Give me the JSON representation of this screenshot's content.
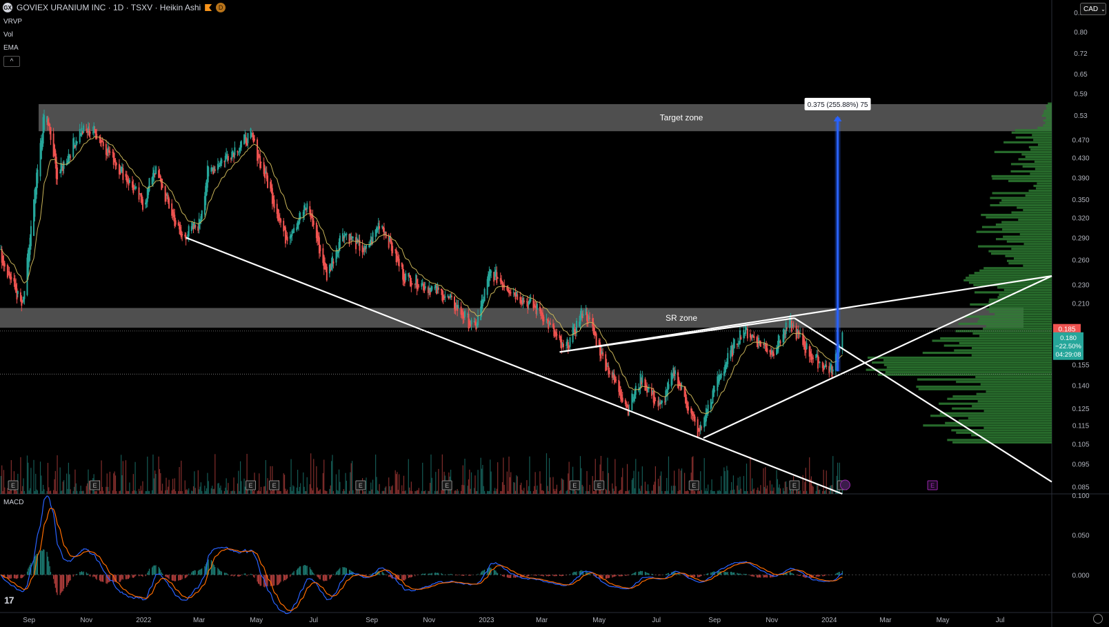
{
  "header": {
    "title": "GOVIEX URANIUM INC · 1D · TSXV · Heikin Ashi",
    "logo_text": "GX",
    "badge_d": "D"
  },
  "indicators": [
    "VRVP",
    "Vol",
    "EMA"
  ],
  "collapse_icon": "chevron-up-icon",
  "currency": "CAD",
  "macd_label": "MACD",
  "price_axis": {
    "labels": [
      "0.88",
      "0.80",
      "0.72",
      "0.65",
      "0.59",
      "0.53",
      "0.470",
      "0.430",
      "0.390",
      "0.350",
      "0.320",
      "0.290",
      "0.260",
      "0.230",
      "0.210",
      "0.155",
      "0.140",
      "0.125",
      "0.115",
      "0.105",
      "0.095",
      "0.085"
    ],
    "current_red": "0.185",
    "current_green": "0.180",
    "change": "−22.50%",
    "countdown": "04:29:08"
  },
  "macd_axis": {
    "labels": [
      "0.100",
      "0.050",
      "0.000"
    ]
  },
  "time_axis": {
    "labels": [
      "Sep",
      "Nov",
      "2022",
      "Mar",
      "May",
      "Jul",
      "Sep",
      "Nov",
      "2023",
      "Mar",
      "May",
      "Jul",
      "Sep",
      "Nov",
      "2024",
      "Mar",
      "May",
      "Jul"
    ]
  },
  "annotations": {
    "target_zone": "Target zone",
    "sr_zone": "SR zone",
    "measure_label": "0.375 (255.88%) 75"
  },
  "earnings_marker": "E",
  "colors": {
    "up": "#26a69a",
    "down": "#ef5350",
    "ema": "#c9b458",
    "zone": "#5d5d5d",
    "vrvp": "#2e7d32",
    "measure": "#2962ff",
    "macd_line": "#2962ff",
    "signal_line": "#ff6d00",
    "earnings": "#9c27b0"
  },
  "chart_data": {
    "type": "candlestick",
    "style": "Heikin Ashi",
    "ylim": [
      0.082,
      0.88
    ],
    "y_scale": "log",
    "anchors": [
      {
        "date": "2021-08-01",
        "price": 0.27
      },
      {
        "date": "2021-08-25",
        "price": 0.205
      },
      {
        "date": "2021-09-05",
        "price": 0.33
      },
      {
        "date": "2021-09-18",
        "price": 0.55
      },
      {
        "date": "2021-10-01",
        "price": 0.39
      },
      {
        "date": "2021-10-25",
        "price": 0.49
      },
      {
        "date": "2021-11-10",
        "price": 0.49
      },
      {
        "date": "2021-12-15",
        "price": 0.385
      },
      {
        "date": "2022-01-01",
        "price": 0.34
      },
      {
        "date": "2022-01-12",
        "price": 0.41
      },
      {
        "date": "2022-02-10",
        "price": 0.29
      },
      {
        "date": "2022-03-01",
        "price": 0.31
      },
      {
        "date": "2022-03-10",
        "price": 0.4
      },
      {
        "date": "2022-04-25",
        "price": 0.48
      },
      {
        "date": "2022-05-15",
        "price": 0.37
      },
      {
        "date": "2022-06-01",
        "price": 0.29
      },
      {
        "date": "2022-06-25",
        "price": 0.34
      },
      {
        "date": "2022-07-15",
        "price": 0.24
      },
      {
        "date": "2022-08-01",
        "price": 0.3
      },
      {
        "date": "2022-08-25",
        "price": 0.27
      },
      {
        "date": "2022-09-10",
        "price": 0.315
      },
      {
        "date": "2022-10-05",
        "price": 0.24
      },
      {
        "date": "2022-11-15",
        "price": 0.22
      },
      {
        "date": "2022-12-01",
        "price": 0.205
      },
      {
        "date": "2022-12-20",
        "price": 0.185
      },
      {
        "date": "2023-01-05",
        "price": 0.245
      },
      {
        "date": "2023-02-01",
        "price": 0.22
      },
      {
        "date": "2023-03-01",
        "price": 0.2
      },
      {
        "date": "2023-03-25",
        "price": 0.165
      },
      {
        "date": "2023-04-15",
        "price": 0.205
      },
      {
        "date": "2023-05-05",
        "price": 0.16
      },
      {
        "date": "2023-06-01",
        "price": 0.125
      },
      {
        "date": "2023-06-15",
        "price": 0.145
      },
      {
        "date": "2023-07-05",
        "price": 0.125
      },
      {
        "date": "2023-07-20",
        "price": 0.15
      },
      {
        "date": "2023-08-15",
        "price": 0.11
      },
      {
        "date": "2023-09-05",
        "price": 0.145
      },
      {
        "date": "2023-10-01",
        "price": 0.185
      },
      {
        "date": "2023-11-01",
        "price": 0.165
      },
      {
        "date": "2023-11-20",
        "price": 0.19
      },
      {
        "date": "2023-12-15",
        "price": 0.16
      },
      {
        "date": "2024-01-05",
        "price": 0.15
      },
      {
        "date": "2024-01-15",
        "price": 0.185
      }
    ],
    "zones": [
      {
        "label": "Target zone",
        "low": 0.49,
        "high": 0.56
      },
      {
        "label": "SR zone",
        "low": 0.186,
        "high": 0.205
      }
    ],
    "trendlines": [
      {
        "from": [
          "2022-02-15",
          0.29
        ],
        "to": [
          "2024-01-15",
          0.082
        ]
      },
      {
        "from": [
          "2023-03-20",
          0.165
        ],
        "to": [
          "2023-11-25",
          0.195
        ]
      },
      {
        "from": [
          "2023-03-20",
          0.165
        ],
        "to": [
          "2024-08-25",
          0.24
        ]
      },
      {
        "from": [
          "2023-11-25",
          0.195
        ],
        "to": [
          "2024-08-25",
          0.087
        ]
      },
      {
        "from": [
          "2023-08-20",
          0.108
        ],
        "to": [
          "2024-08-25",
          0.24
        ]
      }
    ],
    "measure": {
      "date": "2024-01-10",
      "from": 0.15,
      "to": 0.525
    },
    "earnings_dates": [
      "2021-08-15",
      "2021-11-10",
      "2022-04-25",
      "2022-05-20",
      "2022-08-20",
      "2022-11-20",
      "2023-04-05",
      "2023-05-01",
      "2023-08-10",
      "2023-11-25",
      "2024-01-15",
      "2024-04-20"
    ],
    "macd_ylim": [
      -0.03,
      0.1
    ]
  }
}
